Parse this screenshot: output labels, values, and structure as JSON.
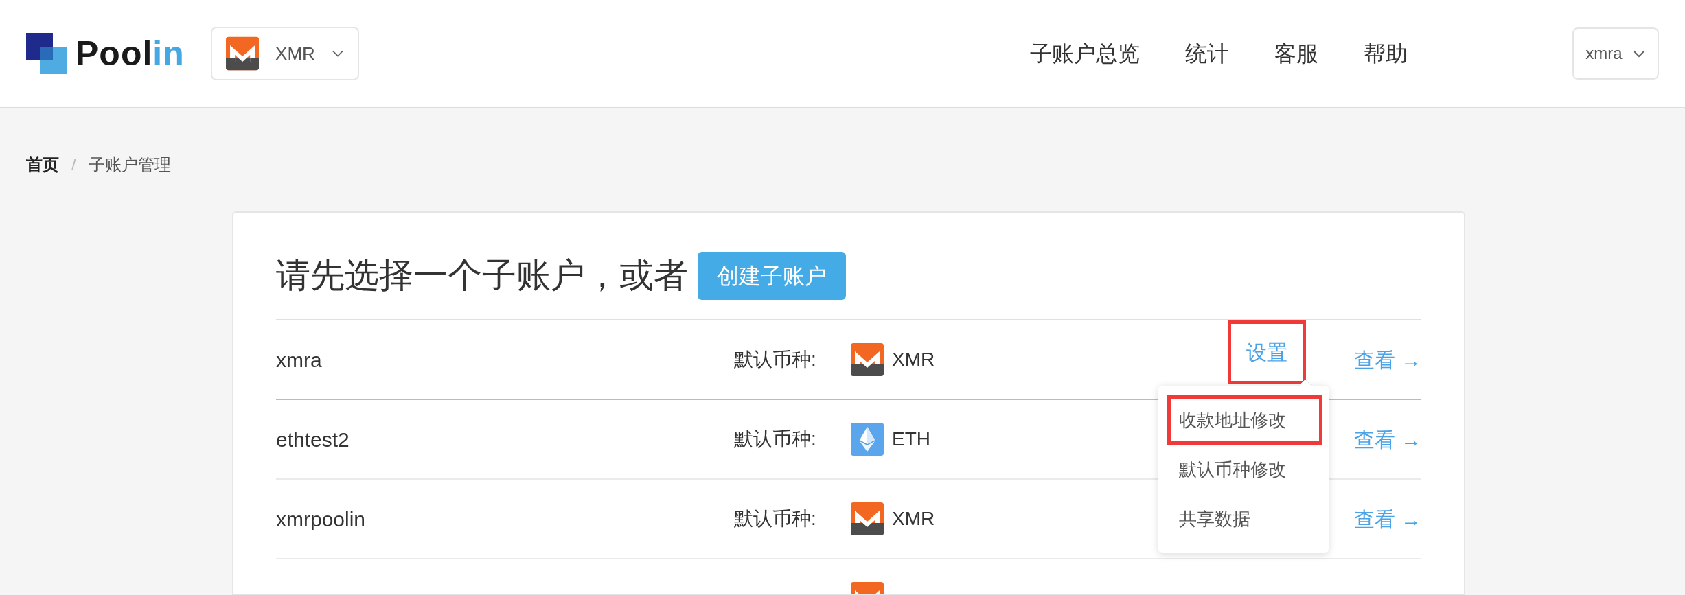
{
  "header": {
    "logo": {
      "text_dark": "Pool",
      "text_accent": "in"
    },
    "coin_selector": {
      "kind": "xmr",
      "label": "XMR"
    },
    "nav": [
      "子账户总览",
      "统计",
      "客服",
      "帮助"
    ],
    "user_menu": {
      "label": "xmra"
    }
  },
  "breadcrumb": {
    "separator": "/",
    "items": [
      {
        "label": "首页",
        "current": false
      },
      {
        "label": "子账户管理",
        "current": true
      }
    ]
  },
  "card": {
    "title": "请先选择一个子账户，或者",
    "create_button": "创建子账户",
    "rows": [
      {
        "name": "xmra",
        "coin_label": "默认币种:",
        "kind": "xmr",
        "coin_name": "XMR",
        "settings": {
          "label": "设置",
          "annotated": true,
          "menu": [
            {
              "label": "收款地址修改",
              "annotated": true
            },
            {
              "label": "默认币种修改",
              "annotated": false
            },
            {
              "label": "共享数据",
              "annotated": false
            }
          ]
        },
        "view": "查看 →",
        "hovered": true
      },
      {
        "name": "ethtest2",
        "coin_label": "默认币种:",
        "kind": "eth",
        "coin_name": "ETH",
        "view": "查看 →",
        "hovered": false
      },
      {
        "name": "xmrpoolin",
        "coin_label": "默认币种:",
        "kind": "xmr",
        "coin_name": "XMR",
        "view": "查看 →",
        "hovered": false
      },
      {
        "kind": "xmr"
      }
    ]
  }
}
